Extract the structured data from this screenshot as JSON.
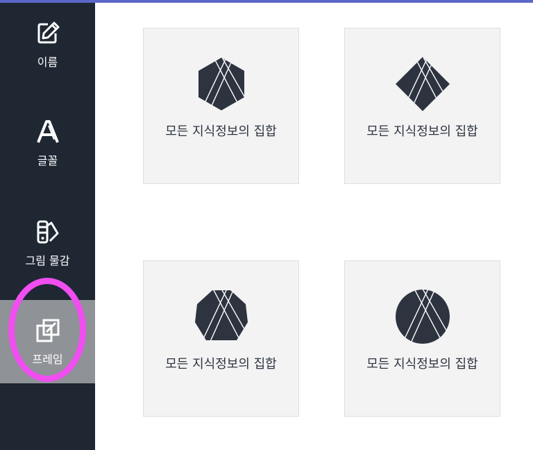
{
  "colors": {
    "accent_bar": "#5b67c8",
    "sidebar_bg": "#1f2733",
    "sidebar_active_bg": "#8f9296",
    "annotation_ring": "#f04ef0",
    "card_bg": "#f3f3f3",
    "shape_fill": "#2d3440"
  },
  "sidebar": {
    "items": [
      {
        "label": "이름",
        "icon": "edit-icon"
      },
      {
        "label": "글꼴",
        "icon": "font-icon"
      },
      {
        "label": "그림 물감",
        "icon": "paint-palette-icon"
      },
      {
        "label": "프레임",
        "icon": "frame-icon",
        "active": true
      }
    ]
  },
  "main": {
    "frames": [
      {
        "caption": "모든 지식정보의 집합",
        "shape": "hexagon"
      },
      {
        "caption": "모든 지식정보의 집합",
        "shape": "diamond"
      },
      {
        "caption": "모든 지식정보의 집합",
        "shape": "octagon"
      },
      {
        "caption": "모든 지식정보의 집합",
        "shape": "circle"
      }
    ]
  }
}
